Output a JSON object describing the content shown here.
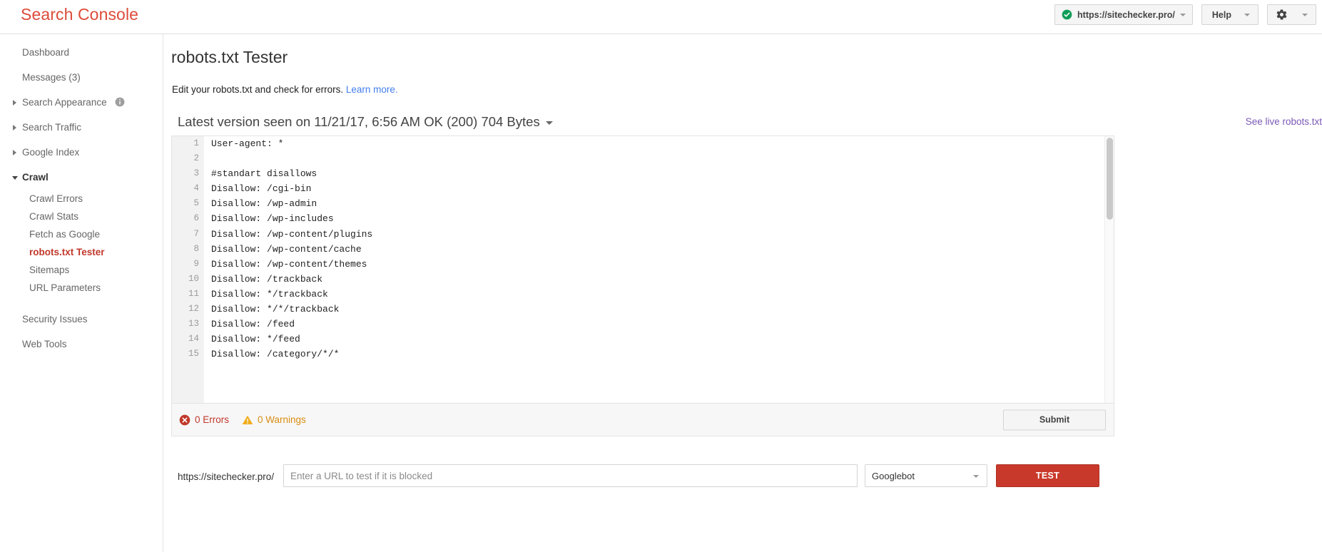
{
  "header": {
    "brand": "Search Console",
    "property": {
      "label": "https://sitechecker.pro/",
      "icon": "verified-check-icon"
    },
    "help_label": "Help",
    "gear_icon": "gear-icon"
  },
  "sidebar": {
    "items": [
      {
        "label": "Dashboard",
        "type": "link"
      },
      {
        "label": "Messages (3)",
        "type": "link"
      },
      {
        "label": "Search Appearance",
        "type": "group",
        "expanded": false,
        "info_icon": "info-icon"
      },
      {
        "label": "Search Traffic",
        "type": "group",
        "expanded": false
      },
      {
        "label": "Google Index",
        "type": "group",
        "expanded": false
      },
      {
        "label": "Crawl",
        "type": "group",
        "expanded": true
      }
    ],
    "crawl_children": [
      {
        "label": "Crawl Errors",
        "active": false
      },
      {
        "label": "Crawl Stats",
        "active": false
      },
      {
        "label": "Fetch as Google",
        "active": false
      },
      {
        "label": "robots.txt Tester",
        "active": true
      },
      {
        "label": "Sitemaps",
        "active": false
      },
      {
        "label": "URL Parameters",
        "active": false
      }
    ],
    "footer_items": [
      {
        "label": "Security Issues"
      },
      {
        "label": "Web Tools"
      }
    ]
  },
  "main": {
    "title": "robots.txt Tester",
    "description": "Edit your robots.txt and check for errors.",
    "learn_more": "Learn more.",
    "version_line": "Latest version seen on 11/21/17, 6:56 AM OK (200) 704 Bytes",
    "see_live_link": "See live robots.txt",
    "editor_lines": [
      {
        "n": "1",
        "text": "User-agent: *"
      },
      {
        "n": "2",
        "text": ""
      },
      {
        "n": "3",
        "text": "#standart disallows"
      },
      {
        "n": "4",
        "text": "Disallow: /cgi-bin"
      },
      {
        "n": "5",
        "text": "Disallow: /wp-admin"
      },
      {
        "n": "6",
        "text": "Disallow: /wp-includes"
      },
      {
        "n": "7",
        "text": "Disallow: /wp-content/plugins"
      },
      {
        "n": "8",
        "text": "Disallow: /wp-content/cache"
      },
      {
        "n": "9",
        "text": "Disallow: /wp-content/themes"
      },
      {
        "n": "10",
        "text": "Disallow: /trackback"
      },
      {
        "n": "11",
        "text": "Disallow: */trackback"
      },
      {
        "n": "12",
        "text": "Disallow: */*/trackback"
      },
      {
        "n": "13",
        "text": "Disallow: /feed"
      },
      {
        "n": "14",
        "text": "Disallow: */feed"
      },
      {
        "n": "15",
        "text": "Disallow: /category/*/*"
      }
    ],
    "status": {
      "errors_label": "0 Errors",
      "warnings_label": "0 Warnings",
      "error_icon": "error-circle-icon",
      "warning_icon": "warning-triangle-icon"
    },
    "submit_label": "Submit",
    "test_bar": {
      "url_prefix": "https://sitechecker.pro/",
      "url_placeholder": "Enter a URL to test if it is blocked",
      "url_value": "",
      "user_agent": "Googlebot",
      "test_label": "TEST"
    }
  },
  "colors": {
    "brand_red": "#dd4b39",
    "active_red": "#c1382b",
    "link_blue": "#427fed",
    "visited_purple": "#7b59b5",
    "test_button_red": "#c9392b",
    "error_red": "#c0392b",
    "warning_orange": "#d98c12",
    "check_green": "#0f9d58"
  }
}
